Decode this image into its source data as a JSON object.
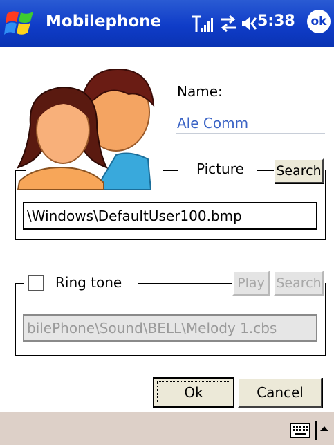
{
  "titlebar": {
    "app_title": "Mobilephone",
    "clock": "5:38",
    "ok_label": "ok",
    "icons": [
      "start-flag-icon",
      "signal-strength-icon",
      "connectivity-icon",
      "speaker-icon"
    ]
  },
  "contact": {
    "name_label": "Name:",
    "name_value": "Ale Comm"
  },
  "picture": {
    "label": "Picture",
    "search_label": "Search",
    "path_value": "\\Windows\\DefaultUser100.bmp"
  },
  "ringtone": {
    "label": "Ring tone",
    "checked": false,
    "play_label": "Play",
    "search_label": "Search",
    "path_value": "bilePhone\\Sound\\BELL\\Melody 1.cbs"
  },
  "dialog": {
    "ok_label": "Ok",
    "cancel_label": "Cancel"
  },
  "bottombar": {
    "icons": [
      "keyboard-icon",
      "sip-arrow-up-icon"
    ]
  },
  "colors": {
    "titlebar": "#0f3cc8",
    "name_value": "#3a63c5",
    "bottombar": "#ddd0c8",
    "button_face": "#ece9d8"
  }
}
